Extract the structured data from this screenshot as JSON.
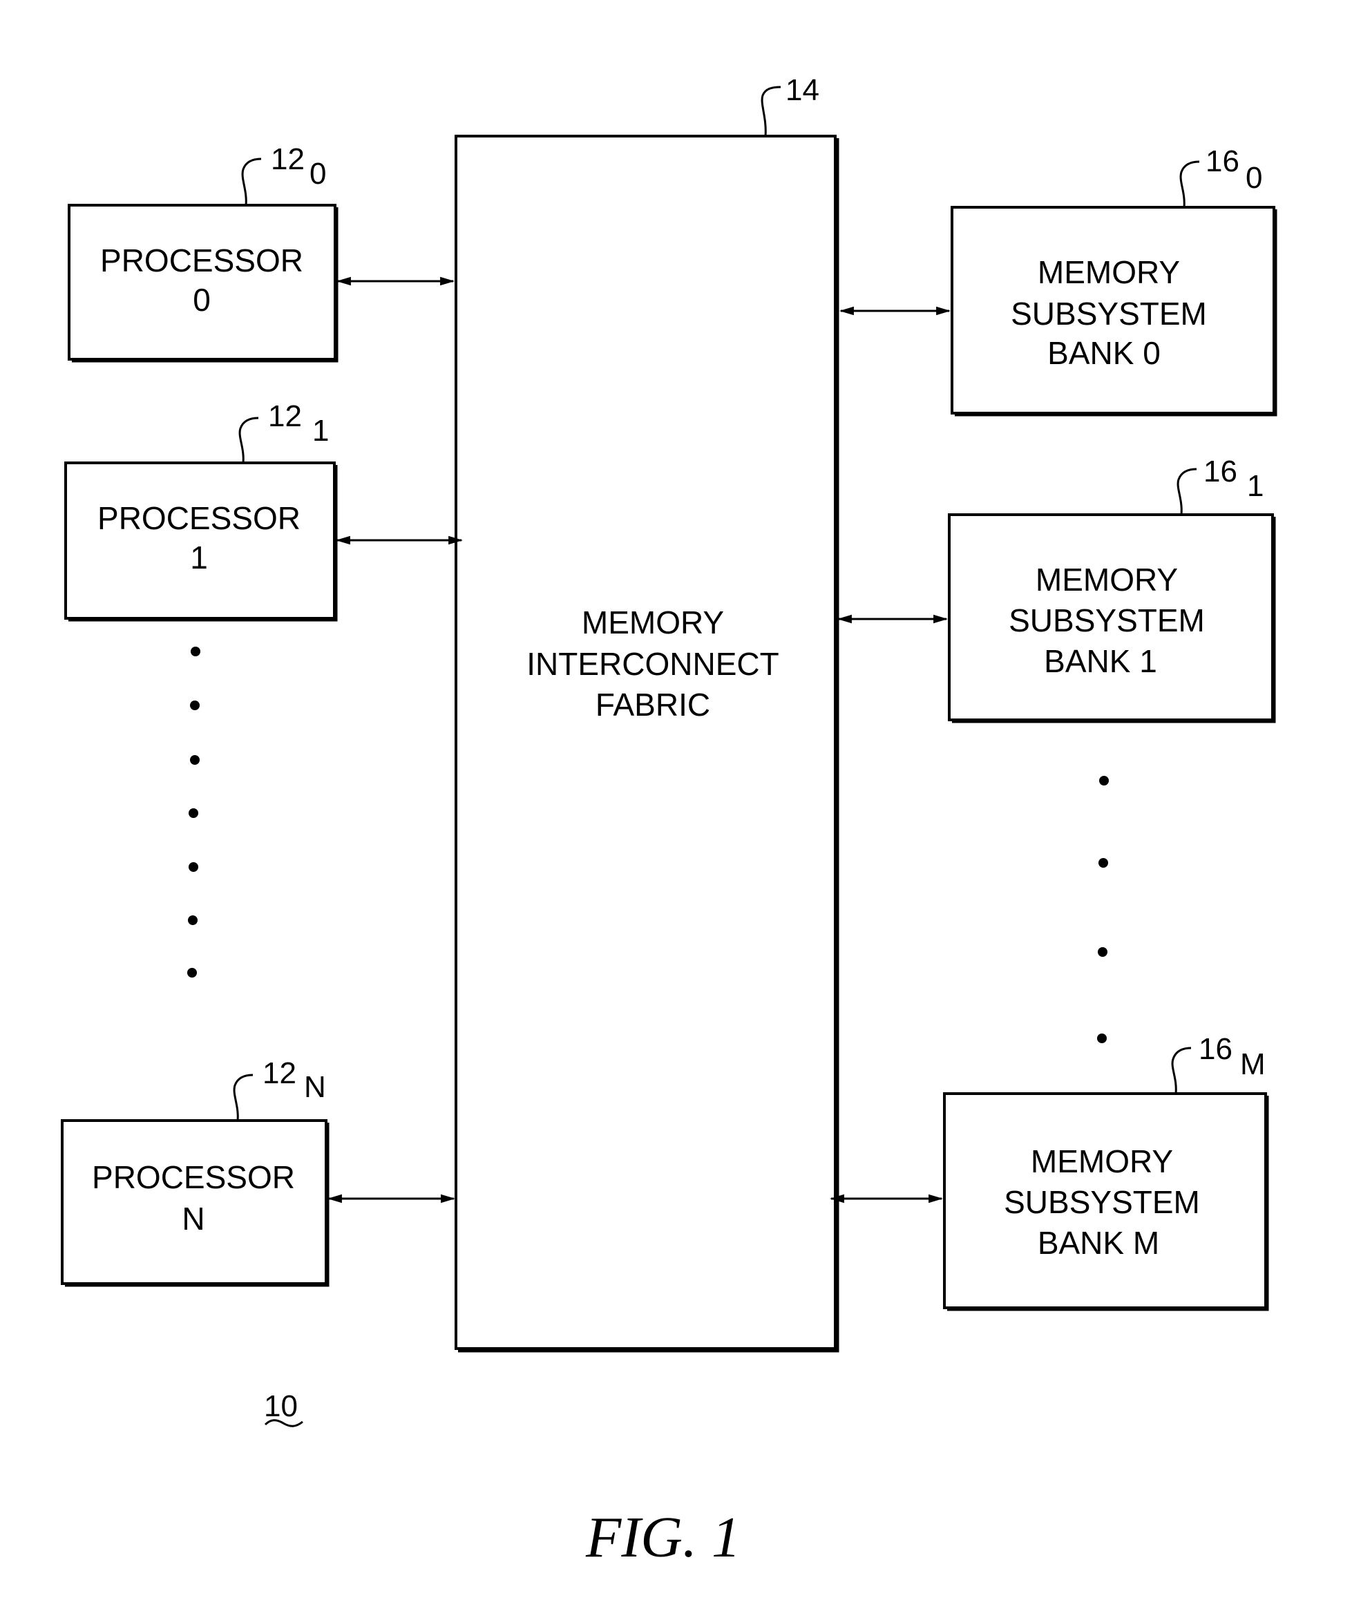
{
  "figure": {
    "caption": "FIG. 1",
    "system_ref": "10"
  },
  "fabric": {
    "ref": "14",
    "lines": [
      "MEMORY",
      "INTERCONNECT",
      "FABRIC"
    ]
  },
  "processors": [
    {
      "ref": "12",
      "sub": "0",
      "lines": [
        "PROCESSOR",
        "0"
      ]
    },
    {
      "ref": "12",
      "sub": "1",
      "lines": [
        "PROCESSOR",
        "1"
      ]
    },
    {
      "ref": "12",
      "sub": "N",
      "lines": [
        "PROCESSOR",
        "N"
      ]
    }
  ],
  "memory_banks": [
    {
      "ref": "16",
      "sub": "0",
      "lines": [
        "MEMORY",
        "SUBSYSTEM",
        "BANK 0"
      ]
    },
    {
      "ref": "16",
      "sub": "1",
      "lines": [
        "MEMORY",
        "SUBSYSTEM",
        "BANK 1"
      ]
    },
    {
      "ref": "16",
      "sub": "M",
      "lines": [
        "MEMORY",
        "SUBSYSTEM",
        "BANK M"
      ]
    }
  ],
  "ellipsis": {
    "processor_dots": 7,
    "memory_dots": 4
  }
}
